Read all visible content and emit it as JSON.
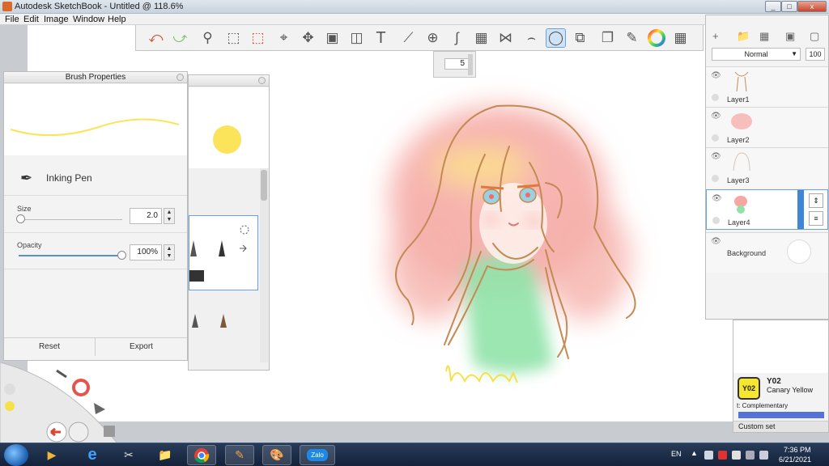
{
  "window": {
    "title": "Autodesk SketchBook - Untitled @ 118.6%",
    "controls": {
      "minimize": "_",
      "maximize": "□",
      "close": "x"
    }
  },
  "menu": [
    "File",
    "Edit",
    "Image",
    "Window",
    "Help"
  ],
  "toolbar": {
    "brush_size_value": "5",
    "tools": [
      "undo-icon",
      "redo-icon",
      "zoom-icon",
      "select-icon",
      "crop-select-icon",
      "crop-icon",
      "transform-icon",
      "distort-icon",
      "fill-icon",
      "text-icon",
      "ruler-icon",
      "ellipse-guide-icon",
      "french-curve-icon",
      "perspective-icon",
      "symmetry-icon",
      "stroke-icon",
      "lasso-icon",
      "shape-icon",
      "copy-icon",
      "brush-library-icon",
      "color-wheel-icon",
      "copic-library-icon"
    ]
  },
  "brush_properties": {
    "header": "Brush Properties",
    "brush_name": "Inking Pen",
    "size": {
      "label": "Size",
      "value": "2.0",
      "fraction": 0.02
    },
    "opacity": {
      "label": "Opacity",
      "value": "100%",
      "fraction": 1.0
    },
    "reset": "Reset",
    "export": "Export",
    "stroke_color": "#fbe45a"
  },
  "layers": {
    "blend_mode": "Normal",
    "opacity": "100",
    "items": [
      {
        "name": "Layer1"
      },
      {
        "name": "Layer2"
      },
      {
        "name": "Layer3"
      },
      {
        "name": "Layer4",
        "selected": true
      },
      {
        "name": "Background"
      }
    ]
  },
  "copic": {
    "code": "Y02",
    "name": "Canary Yellow",
    "complementary": "t: Complementary",
    "custom_set": "Custom set",
    "color": "#f5e630"
  },
  "taskbar": {
    "language": "EN",
    "time": "7:36 PM",
    "date": "6/21/2021",
    "apps": [
      "zalo-app"
    ],
    "zalo_label": "Zalo"
  },
  "colors": {
    "accent": "#3f86d8",
    "hair_stroke": "#c58a52",
    "hair_fill": "#f39a9a",
    "dress_fill": "#8fe3a6",
    "signature": "#f5e14a"
  }
}
